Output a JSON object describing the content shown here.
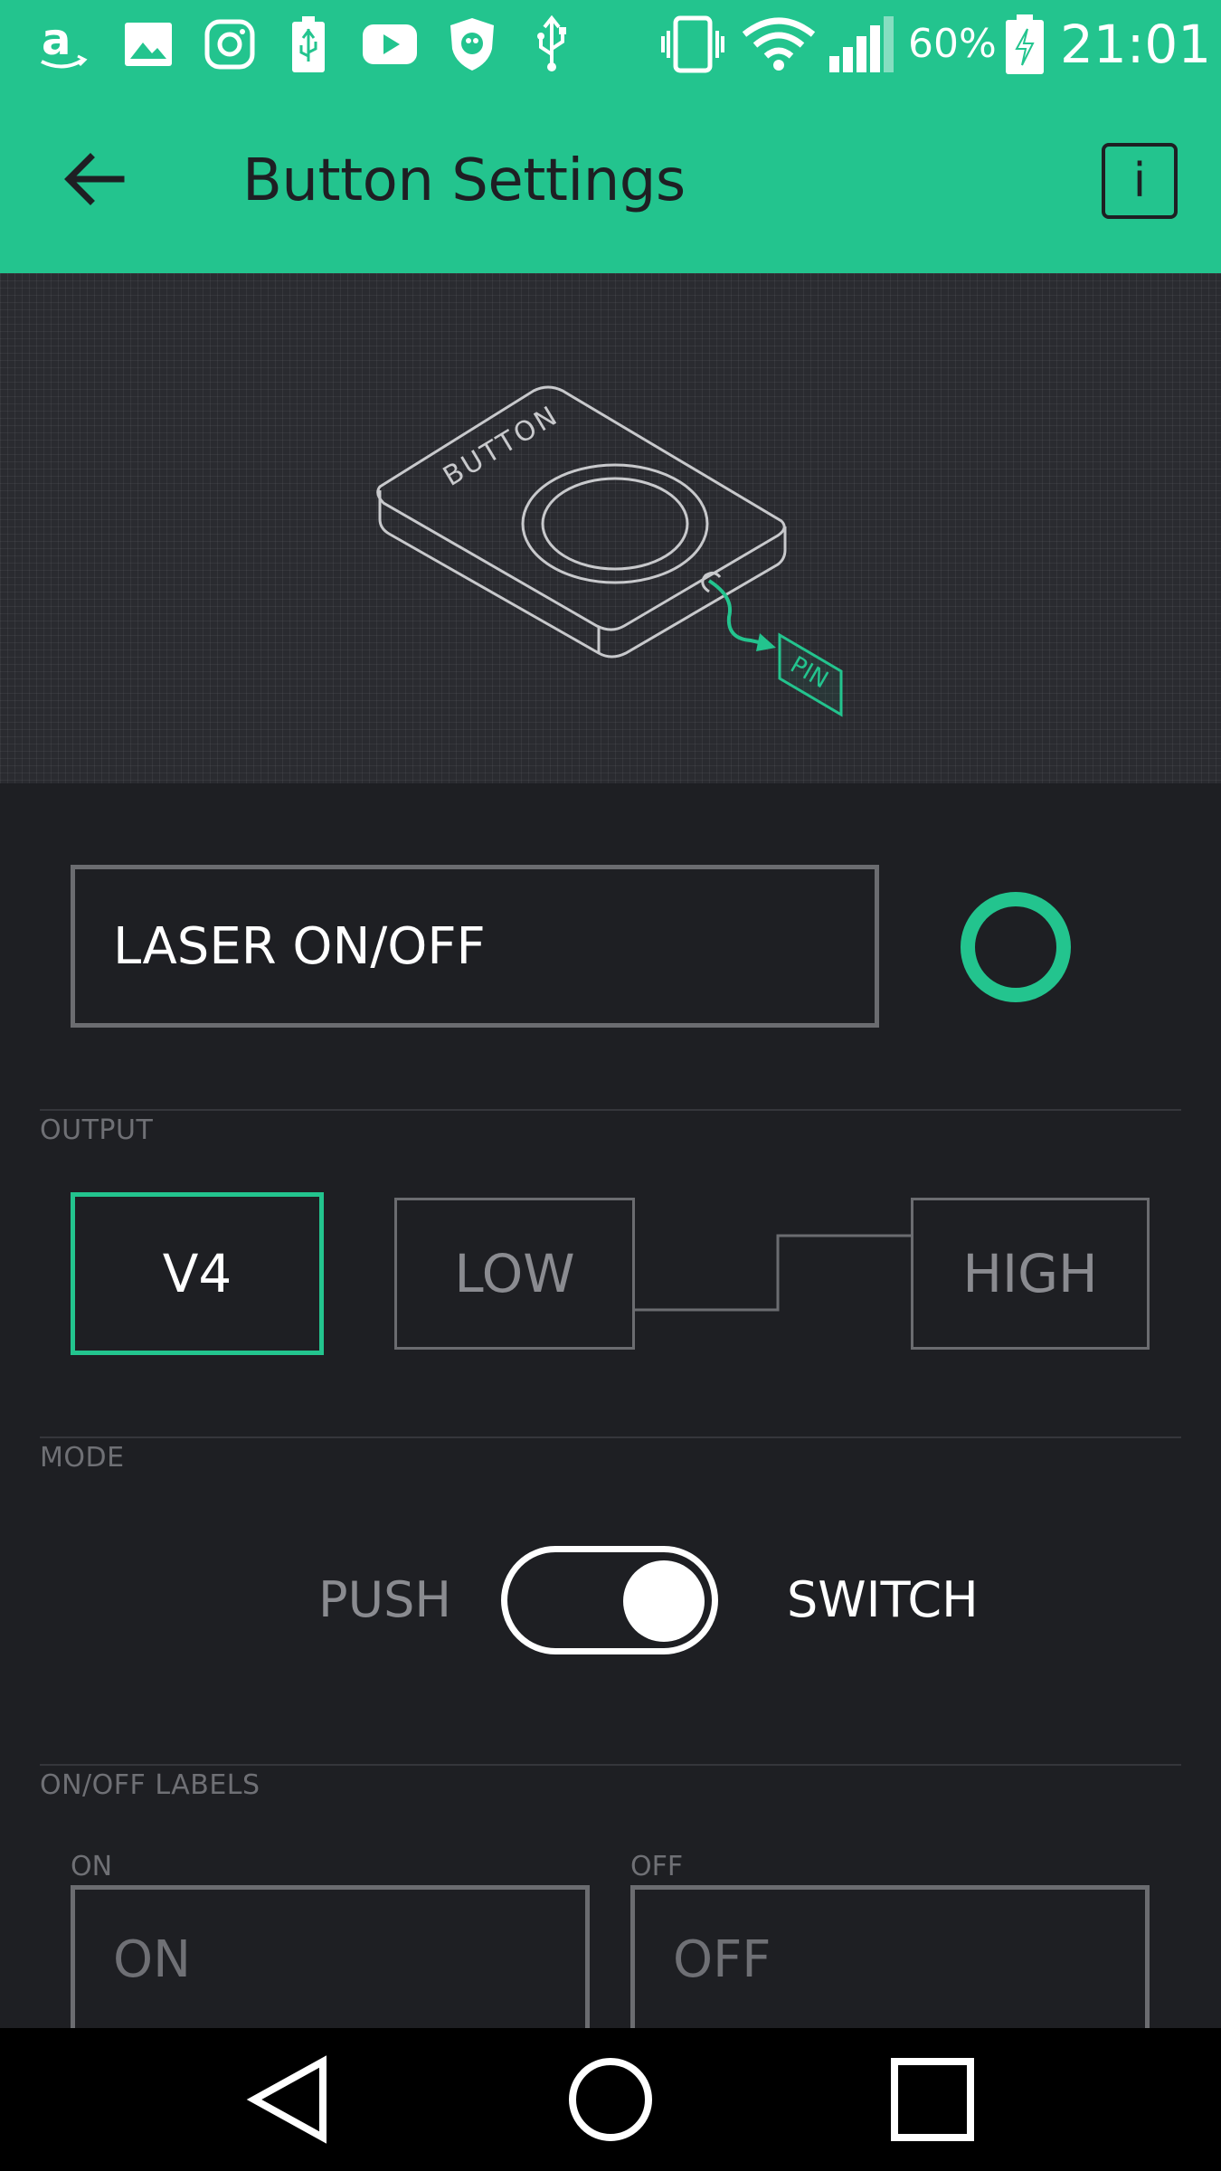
{
  "status_bar": {
    "icons": [
      "amazon-icon",
      "gallery-icon",
      "instagram-icon",
      "usb-icon",
      "youtube-icon",
      "shield-icon",
      "usb-connection-icon",
      "vibrate-icon",
      "wifi-icon",
      "signal-icon",
      "battery-charging-icon"
    ],
    "battery_percent": "60%",
    "time": "21:01"
  },
  "header": {
    "title": "Button Settings",
    "back_icon": "arrow-left-icon",
    "info_label": "i"
  },
  "illustration": {
    "device_label": "BUTTON",
    "pin_label": "PIN"
  },
  "widget": {
    "name_value": "LASER ON/OFF",
    "color": "#23c48e"
  },
  "output": {
    "section_label": "OUTPUT",
    "pin_label": "V4",
    "low_label": "LOW",
    "high_label": "HIGH"
  },
  "mode": {
    "section_label": "MODE",
    "push_label": "PUSH",
    "switch_label": "SWITCH",
    "selected": "SWITCH"
  },
  "labels": {
    "section_label": "ON/OFF LABELS",
    "on_caption": "ON",
    "off_caption": "OFF",
    "on_placeholder": "ON",
    "off_placeholder": "OFF"
  },
  "colors": {
    "accent": "#23c48e",
    "background": "#1e1f23"
  },
  "nav": {
    "icons": [
      "back-triangle-icon",
      "home-circle-icon",
      "recents-square-icon"
    ]
  }
}
